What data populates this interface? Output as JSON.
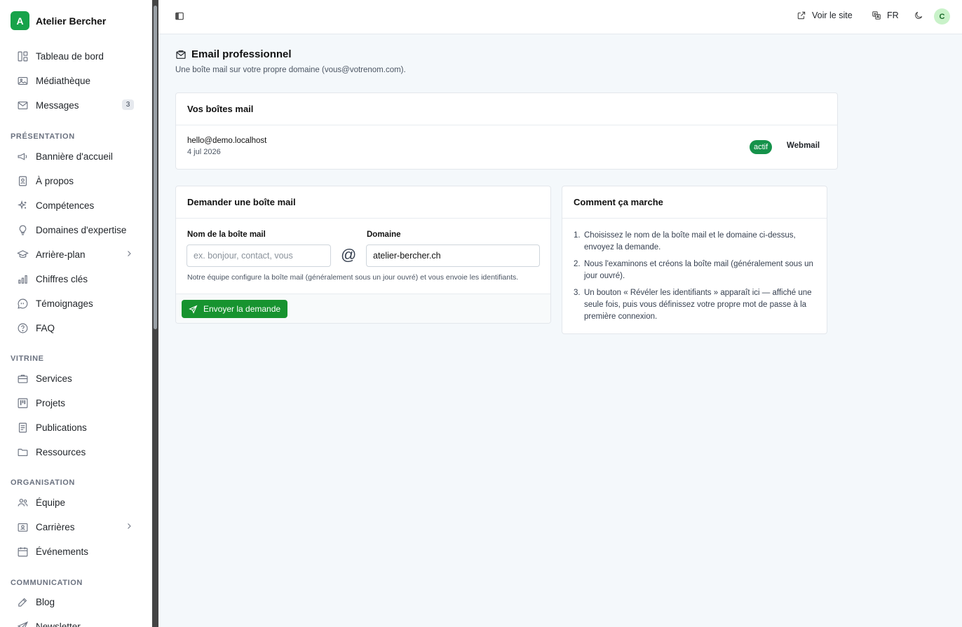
{
  "sidebar": {
    "brand": {
      "initial": "A",
      "name": "Atelier Bercher"
    },
    "items_top": [
      {
        "label": "Tableau de bord",
        "icon": "dashboard-icon"
      },
      {
        "label": "Médiathèque",
        "icon": "image-icon"
      },
      {
        "label": "Messages",
        "icon": "mail-icon",
        "badge": "3"
      }
    ],
    "sections": [
      {
        "label": "PRÉSENTATION",
        "items": [
          {
            "label": "Bannière d'accueil",
            "icon": "megaphone-icon"
          },
          {
            "label": "À propos",
            "icon": "contact-card-icon"
          },
          {
            "label": "Compétences",
            "icon": "sparkles-icon"
          },
          {
            "label": "Domaines d'expertise",
            "icon": "lightbulb-icon"
          },
          {
            "label": "Arrière-plan",
            "icon": "graduation-cap-icon",
            "has_children": true
          },
          {
            "label": "Chiffres clés",
            "icon": "bar-chart-icon"
          },
          {
            "label": "Témoignages",
            "icon": "quote-bubble-icon"
          },
          {
            "label": "FAQ",
            "icon": "help-circle-icon"
          }
        ]
      },
      {
        "label": "VITRINE",
        "items": [
          {
            "label": "Services",
            "icon": "briefcase-icon"
          },
          {
            "label": "Projets",
            "icon": "kanban-icon"
          },
          {
            "label": "Publications",
            "icon": "document-icon"
          },
          {
            "label": "Ressources",
            "icon": "folder-icon"
          }
        ]
      },
      {
        "label": "ORGANISATION",
        "items": [
          {
            "label": "Équipe",
            "icon": "users-icon"
          },
          {
            "label": "Carrières",
            "icon": "id-badge-icon",
            "has_children": true
          },
          {
            "label": "Événements",
            "icon": "calendar-icon"
          }
        ]
      },
      {
        "label": "COMMUNICATION",
        "items": [
          {
            "label": "Blog",
            "icon": "pencil-square-icon"
          },
          {
            "label": "Newsletter",
            "icon": "send-icon"
          }
        ]
      }
    ]
  },
  "topbar": {
    "view_site": "Voir le site",
    "language": "FR",
    "avatar_initial": "C"
  },
  "page": {
    "title": "Email professionnel",
    "subtitle": "Une boîte mail sur votre propre domaine (vous@votrenom.com)."
  },
  "mailboxes": {
    "title": "Vos boîtes mail",
    "items": [
      {
        "address": "hello@demo.localhost",
        "date": "4 jul 2026",
        "status": "actif",
        "action": "Webmail"
      }
    ]
  },
  "request": {
    "title": "Demander une boîte mail",
    "name_label": "Nom de la boîte mail",
    "name_placeholder": "ex. bonjour, contact, vous",
    "at": "@",
    "domain_label": "Domaine",
    "domain_value": "atelier-bercher.ch",
    "help": "Notre équipe configure la boîte mail (généralement sous un jour ouvré) et vous envoie les identifiants.",
    "submit": "Envoyer la demande"
  },
  "how": {
    "title": "Comment ça marche",
    "steps": [
      "Choisissez le nom de la boîte mail et le domaine ci-dessus, envoyez la demande.",
      "Nous l'examinons et créons la boîte mail (généralement sous un jour ouvré).",
      "Un bouton « Révéler les identifiants » apparaît ici — affiché une seule fois, puis vous définissez votre propre mot de passe à la première connexion."
    ]
  },
  "colors": {
    "accent": "#17932f",
    "brand": "#17a34a",
    "page_bg": "#f4f8fb"
  }
}
